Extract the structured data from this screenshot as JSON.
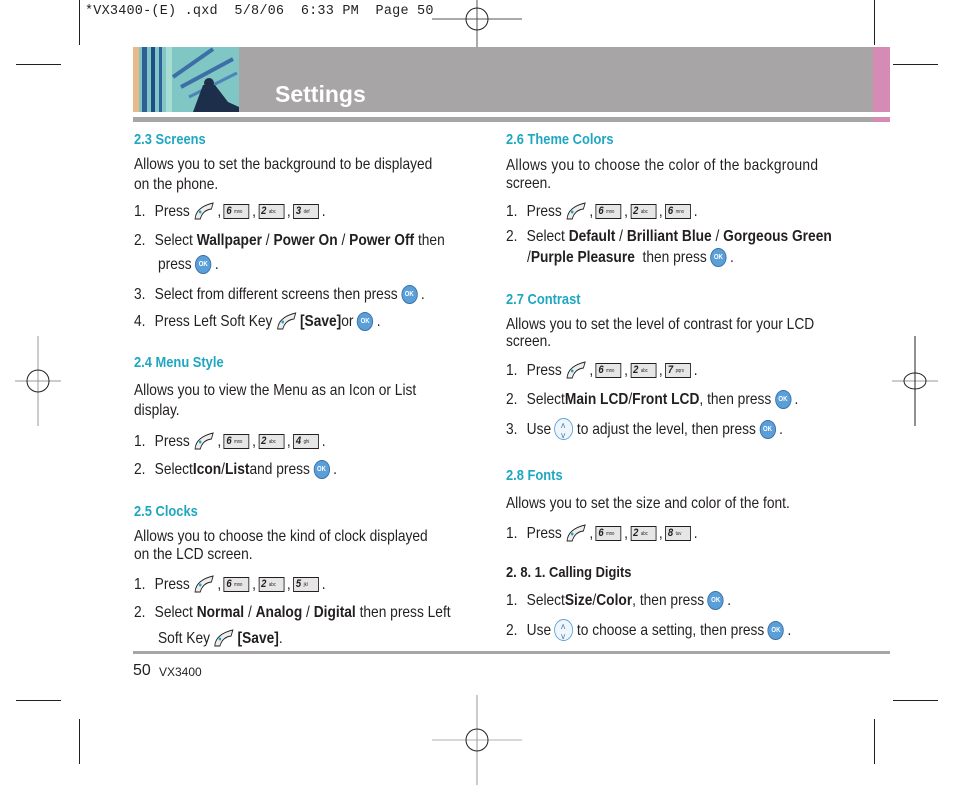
{
  "slug": "*VX3400-(E) .qxd  5/8/06  6:33 PM  Page 50",
  "header": {
    "title": "Settings",
    "accent_color": "#d58bb3",
    "bar_color": "#a7a5a6"
  },
  "icons": {
    "soft_key": "left-soft-key-icon",
    "ok": "ok-key-icon",
    "nav": "navigation-key-icon",
    "ok_label": "OK"
  },
  "left": {
    "s23": {
      "heading": "2.3 Screens",
      "desc": [
        "Allows you to set the background to be displayed",
        "on the phone."
      ],
      "step1": {
        "n": "1.",
        "text": "Press",
        "keys": [
          {
            "d": "6",
            "l": "mno"
          },
          {
            "d": "2",
            "l": "abc"
          },
          {
            "d": "3",
            "l": "def"
          }
        ]
      },
      "step2": {
        "n": "2.",
        "a": "Select ",
        "b1": "Wallpaper",
        "s1": " / ",
        "b2": "Power On",
        "s2": " / ",
        "b3": "Power Off",
        "c": " then",
        "d": "press"
      },
      "step3": {
        "n": "3.",
        "text": "Select from different screens then press"
      },
      "step4": {
        "n": "4.",
        "text": "Press Left Soft Key",
        "b": "[Save]",
        "c": " or"
      }
    },
    "s24": {
      "heading": "2.4 Menu Style",
      "desc": [
        "Allows you to view the Menu as an Icon or List",
        "display."
      ],
      "step1": {
        "n": "1.",
        "text": "Press",
        "keys": [
          {
            "d": "6",
            "l": "mno"
          },
          {
            "d": "2",
            "l": "abc"
          },
          {
            "d": "4",
            "l": "ghi"
          }
        ]
      },
      "step2": {
        "n": "2.",
        "a": "Select ",
        "b1": "Icon",
        "s1": " / ",
        "b2": "List",
        "c": " and press"
      }
    },
    "s25": {
      "heading": "2.5 Clocks",
      "desc": [
        "Allows you to choose the kind of clock displayed",
        "on the LCD screen."
      ],
      "step1": {
        "n": "1.",
        "text": "Press",
        "keys": [
          {
            "d": "6",
            "l": "mno"
          },
          {
            "d": "2",
            "l": "abc"
          },
          {
            "d": "5",
            "l": "jkl"
          }
        ]
      },
      "step2": {
        "n": "2.",
        "a": "Select ",
        "b1": "Normal",
        "s1": " / ",
        "b2": "Analog",
        "s2": " / ",
        "b3": "Digital",
        "c": " then press Left",
        "d": "Soft Key",
        "e": "[Save]",
        "f": "."
      }
    }
  },
  "right": {
    "s26": {
      "heading": "2.6 Theme Colors",
      "desc": [
        "Allows you to choose the color of the background",
        "screen."
      ],
      "step1": {
        "n": "1.",
        "text": "Press",
        "keys": [
          {
            "d": "6",
            "l": "mno"
          },
          {
            "d": "2",
            "l": "abc"
          },
          {
            "d": "6",
            "l": "mno"
          }
        ]
      },
      "step2": {
        "n": "2.",
        "a": "Select ",
        "b1": "Default",
        "s1": " / ",
        "b2": "Brilliant Blue",
        "s2": " / ",
        "b3": "Gorgeous Green",
        "d0": "/ ",
        "b4": "Purple Pleasure",
        "c": "  then press"
      }
    },
    "s27": {
      "heading": "2.7 Contrast",
      "desc": [
        "Allows you to set the level of contrast for your LCD",
        "screen."
      ],
      "step1": {
        "n": "1.",
        "text": "Press",
        "keys": [
          {
            "d": "6",
            "l": "mno"
          },
          {
            "d": "2",
            "l": "abc"
          },
          {
            "d": "7",
            "l": "pqrs"
          }
        ]
      },
      "step2": {
        "n": "2.",
        "a": "Select ",
        "b1": "Main LCD",
        "s1": " / ",
        "b2": "Front LCD",
        "c": ", then press"
      },
      "step3": {
        "n": "3.",
        "a": "Use",
        "c": "to adjust the level, then press"
      }
    },
    "s28": {
      "heading": "2.8 Fonts",
      "desc": [
        "Allows you to set the size and color of the font."
      ],
      "step1": {
        "n": "1.",
        "text": "Press",
        "keys": [
          {
            "d": "6",
            "l": "mno"
          },
          {
            "d": "2",
            "l": "abc"
          },
          {
            "d": "8",
            "l": "tuv"
          }
        ]
      },
      "sub": "2. 8. 1. Calling Digits",
      "sub1": {
        "n": "1.",
        "a": "Select ",
        "b1": "Size",
        "s1": " / ",
        "b2": "Color",
        "c": ", then press"
      },
      "sub2": {
        "n": "2.",
        "a": "Use",
        "c": "to choose a setting, then press"
      }
    }
  },
  "footer": {
    "page": "50",
    "model": "VX3400"
  }
}
